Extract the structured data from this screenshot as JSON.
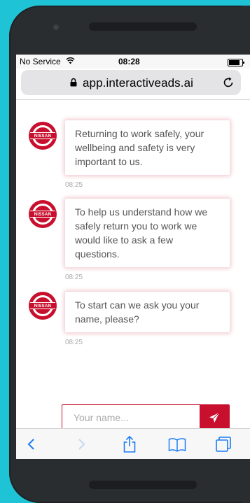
{
  "status_bar": {
    "carrier": "No Service",
    "time": "08:28"
  },
  "browser": {
    "url": "app.interactiveads.ai"
  },
  "brand": {
    "name": "NISSAN",
    "accent_color": "#c8102e"
  },
  "messages": [
    {
      "text": "Returning to work safely, your wellbeing and safety is very important to us.",
      "time": "08:25"
    },
    {
      "text": "To help us understand how we safely return you to work we would like to ask a few questions.",
      "time": "08:25"
    },
    {
      "text": "To start can we ask you your name, please?",
      "time": "08:25"
    }
  ],
  "name_input": {
    "placeholder": "Your name...",
    "value": ""
  },
  "icons": {
    "send": "paper-plane-icon",
    "lock": "lock-icon",
    "reload": "reload-icon",
    "back": "chevron-left-icon",
    "forward": "chevron-right-icon",
    "share": "share-icon",
    "bookmarks": "book-icon",
    "tabs": "tabs-icon"
  }
}
